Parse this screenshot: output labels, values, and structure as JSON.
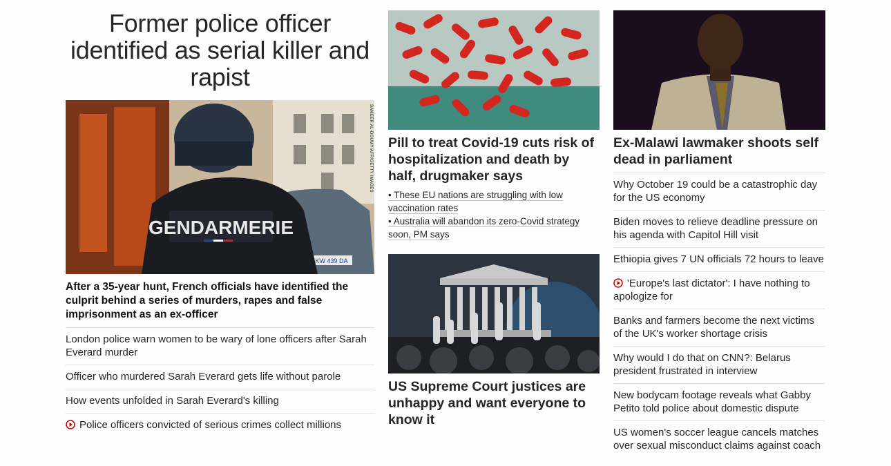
{
  "lead": {
    "headline": "Former police officer identified as serial killer and rapist",
    "image_credit": "SAMEER AL-DOUMY/AFP/GETTY IMAGES",
    "image_vest_text": "GENDARMERIE",
    "image_plate_text": "KW 439 DA",
    "summary": "After a 35-year hunt, French officials have identified the culprit behind a series of murders, rapes and false imprisonment as an ex-officer",
    "links": [
      {
        "text": "London police warn women to be wary of lone officers after Sarah Everard murder",
        "icon": ""
      },
      {
        "text": "Officer who murdered Sarah Everard gets life without parole",
        "icon": ""
      },
      {
        "text": "How events unfolded in Sarah Everard's killing",
        "icon": ""
      },
      {
        "text": "Police officers convicted of serious crimes collect millions",
        "icon": "play-icon"
      }
    ]
  },
  "middle": {
    "story1": {
      "title": "Pill to treat Covid-19 cuts risk of hospitalization and death by half, drugmaker says",
      "bullets": [
        "• These EU nations are struggling with low vaccination rates",
        "• Australia will abandon its zero-Covid strategy soon, PM says"
      ]
    },
    "story2": {
      "title": "US Supreme Court justices are unhappy and want everyone to know it"
    }
  },
  "right": {
    "title": "Ex-Malawi lawmaker shoots self dead in parliament",
    "links": [
      {
        "text": "Why October 19 could be a catastrophic day for the US economy",
        "icon": ""
      },
      {
        "text": "Biden moves to relieve deadline pressure on his agenda with Capitol Hill visit",
        "icon": ""
      },
      {
        "text": "Ethiopia gives 7 UN officials 72 hours to leave",
        "icon": ""
      },
      {
        "text": "'Europe's last dictator': I have nothing to apologize for",
        "icon": "play-icon"
      },
      {
        "text": "Banks and farmers become the next victims of the UK's worker shortage crisis",
        "icon": ""
      },
      {
        "text": "Why would I do that on CNN?: Belarus president frustrated in interview",
        "icon": ""
      },
      {
        "text": "New bodycam footage reveals what Gabby Petito told police about domestic dispute",
        "icon": ""
      },
      {
        "text": "US women's soccer league cancels matches over sexual misconduct claims against coach",
        "icon": ""
      }
    ]
  },
  "colors": {
    "play_icon": "#cc0000",
    "headline": "#262626",
    "divider": "#e2e2e2"
  }
}
